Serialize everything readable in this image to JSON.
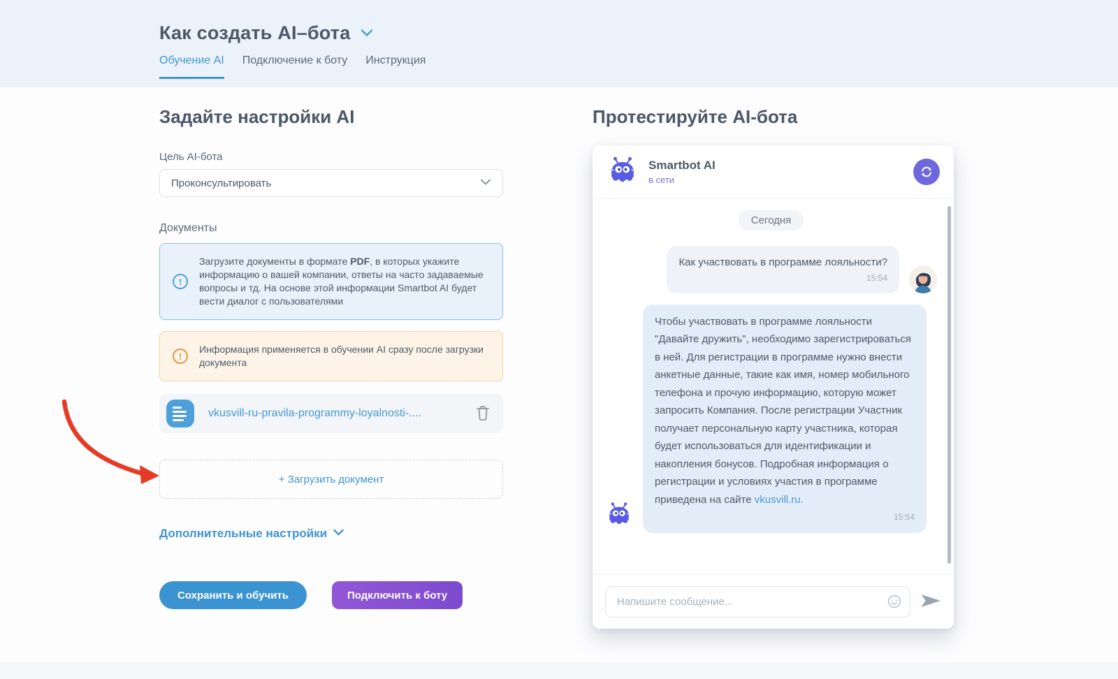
{
  "header": {
    "title": "Как создать AI–бота",
    "tabs": [
      {
        "label": "Обучение AI",
        "active": true
      },
      {
        "label": "Подключение к боту",
        "active": false
      },
      {
        "label": "Инструкция",
        "active": false
      }
    ]
  },
  "settings": {
    "heading": "Задайте настройки AI",
    "goal_label": "Цель AI-бота",
    "goal_value": "Проконсультировать",
    "documents_label": "Документы",
    "info_note_prefix": "Загрузите документы в формате ",
    "info_note_bold": "PDF",
    "info_note_suffix": ", в которых укажите информацию о вашей компании, ответы на часто задаваемые вопросы и тд. На основе этой информации Smartbot AI будет вести диалог с пользователями",
    "warning_note": "Информация применяется в обучении AI сразу после загрузки документа",
    "file_name": "vkusvill-ru-pravila-programmy-loyalnosti-....",
    "upload_button": "+ Загрузить документ",
    "advanced_settings": "Дополнительные настройки",
    "save_button": "Сохранить и обучить",
    "connect_button": "Подключить к боту"
  },
  "chat": {
    "heading": "Протестируйте AI-бота",
    "bot_name": "Smartbot AI",
    "bot_status": "в сети",
    "date_badge": "Сегодня",
    "user_message": {
      "text": "Как участвовать в программе лояльности?",
      "time": "15:54"
    },
    "bot_message": {
      "text": "Чтобы участвовать в программе лояльности \"Давайте дружить\", необходимо зарегистрироваться в ней. Для регистрации в программе нужно внести анкетные данные, такие как имя, номер мобильного телефона и прочую информацию, которую может запросить Компания. После регистрации Участник получает персональную карту участника, которая будет использоваться для идентификации и накопления бонусов. Подробная информация о регистрации и условиях участия в программе приведена на сайте ",
      "link": "vkusvill.ru.",
      "time": "15:54"
    },
    "input_placeholder": "Напишите сообщение..."
  },
  "colors": {
    "accent_blue": "#3f95d0",
    "accent_purple": "#6f68dd",
    "button_purple": "#8a56d4",
    "warning_orange": "#dd9a43",
    "arrow_red": "#e63a26",
    "top_band": "#ecf2f9",
    "bot_bubble": "#e3edf8",
    "user_bubble": "#eff2f6"
  }
}
